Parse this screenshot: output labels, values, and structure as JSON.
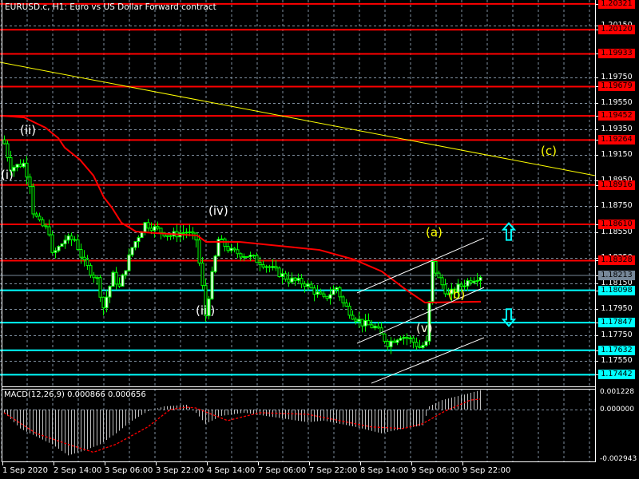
{
  "header": {
    "title": "EURUSD.c, H1:  Euro vs US Dollar Forward contract"
  },
  "macd": {
    "title": "MACD(12,26,9) 0.000866 0.000656"
  },
  "colors": {
    "bg": "#000000",
    "grid": "#8090a0",
    "candle": "#00ff00",
    "resistance": "#ff0000",
    "support": "#00ffff",
    "current": "#778899",
    "trend": "#ffff00",
    "channel": "#ffffff",
    "ma": "#ff0000"
  },
  "chart_data": {
    "type": "candlestick",
    "symbol": "EURUSD.c",
    "timeframe": "H1",
    "y_range": [
      1.17442,
      1.20321
    ],
    "price_grid_labels": [
      "1.20150",
      "1.19750",
      "1.19550",
      "1.19350",
      "1.19150",
      "1.18950",
      "1.18750",
      "1.18550",
      "1.18350",
      "1.18150",
      "1.17950",
      "1.17750",
      "1.17550"
    ],
    "resistance_levels": [
      "1.20321",
      "1.20120",
      "1.19933",
      "1.19679",
      "1.19452",
      "1.19264",
      "1.18916",
      "1.18610",
      "1.18328"
    ],
    "support_levels": [
      "1.18098",
      "1.17847",
      "1.17632",
      "1.17442"
    ],
    "current_price": "1.18213",
    "time_labels": [
      "1 Sep 2020",
      "2 Sep 14:00",
      "3 Sep 06:00",
      "3 Sep 22:00",
      "4 Sep 14:00",
      "7 Sep 06:00",
      "7 Sep 22:00",
      "8 Sep 14:00",
      "9 Sep 06:00",
      "9 Sep 22:00"
    ],
    "bars_count": 150,
    "close_waypoints": [
      [
        0,
        1.19236
      ],
      [
        2,
        1.1905
      ],
      [
        6,
        1.19081
      ],
      [
        8,
        1.18926
      ],
      [
        9,
        1.18709
      ],
      [
        11,
        1.18616
      ],
      [
        14,
        1.18554
      ],
      [
        15,
        1.18368
      ],
      [
        19,
        1.18492
      ],
      [
        22,
        1.18492
      ],
      [
        25,
        1.18306
      ],
      [
        29,
        1.18182
      ],
      [
        31,
        1.17965
      ],
      [
        34,
        1.18213
      ],
      [
        36,
        1.1812
      ],
      [
        40,
        1.1843
      ],
      [
        44,
        1.18616
      ],
      [
        49,
        1.18554
      ],
      [
        52,
        1.18523
      ],
      [
        57,
        1.18554
      ],
      [
        60,
        1.18492
      ],
      [
        62,
        1.1812
      ],
      [
        63,
        1.17903
      ],
      [
        65,
        1.18213
      ],
      [
        67,
        1.18492
      ],
      [
        71,
        1.18399
      ],
      [
        76,
        1.18368
      ],
      [
        81,
        1.18306
      ],
      [
        85,
        1.18244
      ],
      [
        89,
        1.18182
      ],
      [
        94,
        1.18151
      ],
      [
        97,
        1.18089
      ],
      [
        100,
        1.18027
      ],
      [
        104,
        1.1812
      ],
      [
        106,
        1.17996
      ],
      [
        109,
        1.17903
      ],
      [
        112,
        1.17841
      ],
      [
        116,
        1.1781
      ],
      [
        120,
        1.17686
      ],
      [
        124,
        1.17748
      ],
      [
        127,
        1.17717
      ],
      [
        130,
        1.17655
      ],
      [
        132,
        1.17686
      ],
      [
        134,
        1.18306
      ],
      [
        136,
        1.18182
      ],
      [
        139,
        1.18058
      ],
      [
        142,
        1.1812
      ],
      [
        146,
        1.18182
      ],
      [
        149,
        1.18213
      ]
    ],
    "moving_average": [
      [
        -1.25,
        1.19453
      ],
      [
        6.25,
        1.1944
      ],
      [
        13,
        1.1936
      ],
      [
        17,
        1.19279
      ],
      [
        19,
        1.19205
      ],
      [
        23.75,
        1.19112
      ],
      [
        28,
        1.18988
      ],
      [
        31.25,
        1.1882
      ],
      [
        33.75,
        1.1874
      ],
      [
        36.75,
        1.18622
      ],
      [
        41.25,
        1.18554
      ],
      [
        47,
        1.18542
      ],
      [
        60.5,
        1.18523
      ],
      [
        63.25,
        1.18473
      ],
      [
        73.75,
        1.18473
      ],
      [
        98.75,
        1.18411
      ],
      [
        109.5,
        1.18337
      ],
      [
        118.25,
        1.18244
      ],
      [
        125.5,
        1.18108
      ],
      [
        131.75,
        1.18002
      ],
      [
        149.25,
        1.18009
      ]
    ],
    "trendline": [
      [
        -1.25,
        1.19868
      ],
      [
        185,
        1.18988
      ]
    ],
    "channel": [
      [
        [
          110.5,
          1.18077
        ],
        [
          150.25,
          1.18504
        ]
      ],
      [
        [
          110.5,
          1.17686
        ],
        [
          150.25,
          1.1812
        ]
      ],
      [
        [
          115,
          1.17376
        ],
        [
          150.25,
          1.1773
        ]
      ]
    ],
    "wave_labels": [
      {
        "text": "(i)",
        "bar": 1,
        "price": 1.18987,
        "color": "#ffffff"
      },
      {
        "text": "(ii)",
        "bar": 7,
        "price": 1.19335,
        "color": "#ffffff"
      },
      {
        "text": "(iii)",
        "bar": 62,
        "price": 1.17933,
        "color": "#ffffff"
      },
      {
        "text": "(iv)",
        "bar": 66,
        "price": 1.18709,
        "color": "#ffffff"
      },
      {
        "text": "(v)",
        "bar": 131,
        "price": 1.178,
        "color": "#ffffe0"
      },
      {
        "text": "(a)",
        "bar": 134,
        "price": 1.18541,
        "color": "#ffff00"
      },
      {
        "text": "(b)",
        "bar": 141,
        "price": 1.18058,
        "color": "#ffff00"
      },
      {
        "text": "(c)",
        "bar": 170,
        "price": 1.19174,
        "color": "#ffff00"
      }
    ],
    "signal_arrows": [
      {
        "dir": "up",
        "price": 1.1855
      },
      {
        "dir": "down",
        "price": 1.17889
      }
    ],
    "macd_range": [
      -0.002943,
      0.001228
    ],
    "macd_axis_labels": [
      "0.001228",
      "0.000000",
      "-0.002943"
    ],
    "macd_histogram": [
      [
        0,
        -0.0002
      ],
      [
        5,
        -0.0012
      ],
      [
        15,
        -0.0022
      ],
      [
        20,
        -0.0029
      ],
      [
        25,
        -0.0026
      ],
      [
        30,
        -0.0022
      ],
      [
        35,
        -0.0015
      ],
      [
        40,
        -0.0007
      ],
      [
        45,
        -0.0001
      ],
      [
        50,
        0.0002
      ],
      [
        57,
        0.0003
      ],
      [
        60,
        -0.0002
      ],
      [
        63,
        -0.0009
      ],
      [
        68,
        -0.0004
      ],
      [
        75,
        -0.0002
      ],
      [
        85,
        -0.0005
      ],
      [
        95,
        -0.0008
      ],
      [
        100,
        -0.0007
      ],
      [
        105,
        -0.0009
      ],
      [
        110,
        -0.0011
      ],
      [
        118,
        -0.0015
      ],
      [
        125,
        -0.0012
      ],
      [
        131,
        -0.001
      ],
      [
        133,
        0.0002
      ],
      [
        137,
        0.0006
      ],
      [
        145,
        0.001
      ],
      [
        149,
        0.00123
      ]
    ],
    "macd_signal": [
      [
        0,
        -0.0002
      ],
      [
        10,
        -0.0015
      ],
      [
        20,
        -0.0022
      ],
      [
        28,
        -0.0027
      ],
      [
        35,
        -0.0022
      ],
      [
        45,
        -0.0011
      ],
      [
        52,
        0
      ],
      [
        57,
        0.00015
      ],
      [
        60,
        0.0001
      ],
      [
        70,
        -0.0007
      ],
      [
        80,
        -0.0002
      ],
      [
        95,
        -0.0003
      ],
      [
        105,
        -0.0007
      ],
      [
        115,
        -0.0011
      ],
      [
        125,
        -0.0012
      ],
      [
        131,
        -0.0009
      ],
      [
        138,
        -0.0001
      ],
      [
        146,
        0.0006
      ],
      [
        149,
        0.00066
      ]
    ],
    "macd_main_value": "0.000866",
    "macd_signal_value": "0.000656"
  }
}
